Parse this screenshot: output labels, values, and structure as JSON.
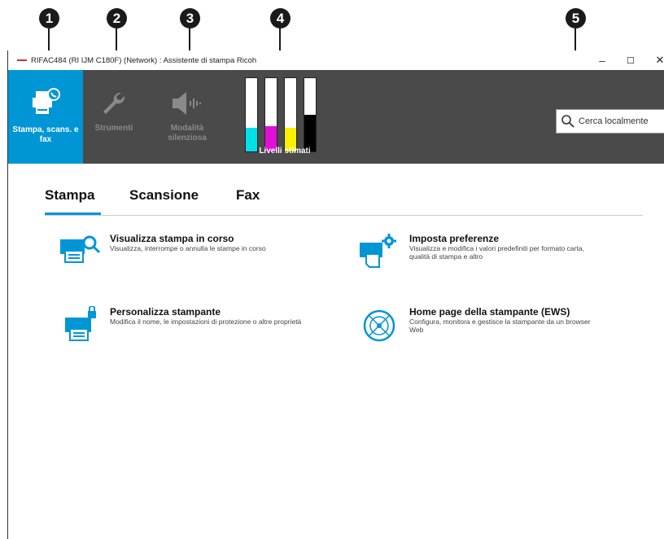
{
  "callouts": [
    "1",
    "2",
    "3",
    "4",
    "5"
  ],
  "window": {
    "title": "RIFAC484 (RI IJM C180F) (Network) : Assistente di stampa Ricoh",
    "minimize": "–",
    "maximize": "☐",
    "close": "✕"
  },
  "toolbar": {
    "items": [
      {
        "label": "Stampa, scans. e fax",
        "icon": "printer-scan-fax-icon",
        "state": "selected"
      },
      {
        "label": "Strumenti",
        "icon": "wrench-icon",
        "state": "disabled"
      },
      {
        "label": "Modalità silenziosa",
        "icon": "speaker-quiet-icon",
        "state": "disabled"
      }
    ],
    "ink_levels": {
      "label": "Livelli stimati",
      "cartridges": [
        {
          "color": "cyan",
          "hex": "#00e0e8",
          "level": 0.32
        },
        {
          "color": "magenta",
          "hex": "#e010d8",
          "level": 0.35
        },
        {
          "color": "yellow",
          "hex": "#f8f000",
          "level": 0.32
        },
        {
          "color": "black",
          "hex": "#000000",
          "level": 0.5
        }
      ]
    },
    "search": {
      "placeholder": "Cerca localmente",
      "icon": "search-icon"
    }
  },
  "tabs": [
    {
      "label": "Stampa",
      "active": true
    },
    {
      "label": "Scansione",
      "active": false
    },
    {
      "label": "Fax",
      "active": false
    }
  ],
  "tasks": [
    {
      "title": "Visualizza stampa in corso",
      "desc": "Visualizza, interrompe o annulla le stampe in corso",
      "icon": "print-queue-icon"
    },
    {
      "title": "Imposta preferenze",
      "desc": "Visualizza e modifica i valori predefiniti per formato carta, qualità di stampa e altro",
      "icon": "printer-preferences-icon"
    },
    {
      "title": "Personalizza stampante",
      "desc": "Modifica il nome, le impostazioni di protezione o altre proprietà",
      "icon": "printer-lock-icon"
    },
    {
      "title": "Home page della stampante (EWS)",
      "desc": "Configura, monitora e gestisce la stampante da un browser Web",
      "icon": "globe-icon"
    }
  ],
  "colors": {
    "accent": "#0096d6",
    "toolbar_bg": "#4a4a4a"
  }
}
